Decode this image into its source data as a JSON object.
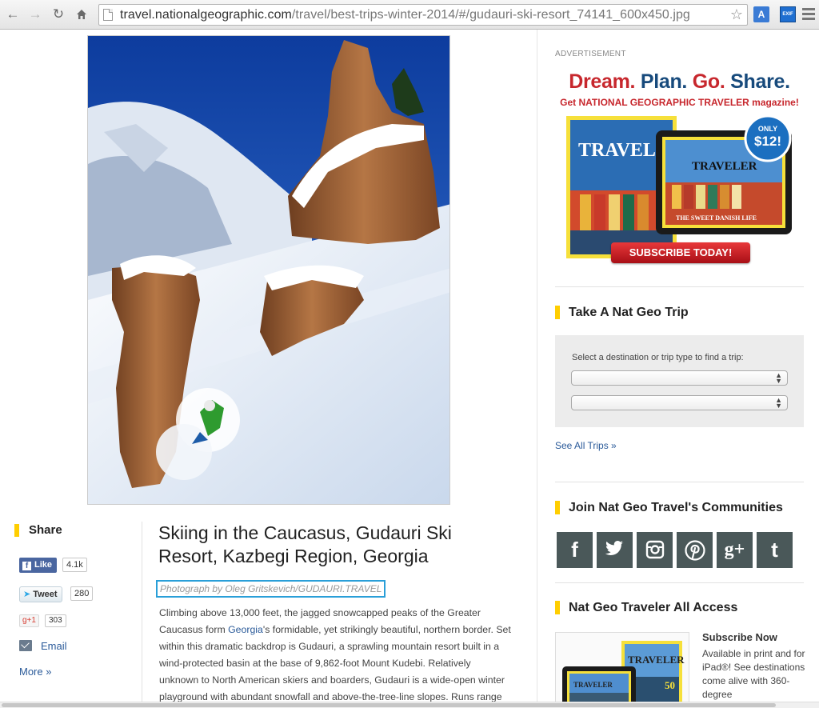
{
  "browser": {
    "url_host": "travel.nationalgeographic.com",
    "url_path": "/travel/best-trips-winter-2014/#/gudauri-ski-resort_74141_600x450.jpg",
    "ext1_label": "A",
    "ext2_label": "EXIF"
  },
  "share": {
    "heading": "Share",
    "like_label": "Like",
    "like_count": "4.1k",
    "tweet_label": "Tweet",
    "tweet_count": "280",
    "gplus_label": "g+1",
    "gplus_count": "303",
    "email_label": "Email",
    "more_label": "More »"
  },
  "article": {
    "title": "Skiing in the Caucasus, Gudauri Ski Resort, Kazbegi Region, Georgia",
    "credit": "Photograph by Oleg Gritskevich/GUDAURI.TRAVEL",
    "body_before_link": "Climbing above 13,000 feet, the jagged snowcapped peaks of the Greater Caucasus form ",
    "body_link": "Georgia",
    "body_after_link": "'s formidable, yet strikingly beautiful, northern border. Set within this dramatic backdrop is Gudauri, a sprawling mountain resort built in a wind-protected basin at the base of 9,862-foot Mount Kudebi. Relatively unknown to North American skiers and boarders, Gudauri is a wide-open winter playground with abundant snowfall and above-the-tree-line slopes. Runs range"
  },
  "sidebar": {
    "ad_label": "ADVERTISEMENT",
    "ad_headline_1": "Dream.",
    "ad_headline_2": "Plan.",
    "ad_headline_3": "Go.",
    "ad_headline_4": "Share.",
    "ad_sub": "Get NATIONAL GEOGRAPHIC TRAVELER magazine!",
    "ad_price_top": "ONLY",
    "ad_price": "$12!",
    "ad_mag_title": "TRAVELER",
    "ad_mag_cover_text": "THE SWEET DANISH LIFE",
    "ad_button": "SUBSCRIBE TODAY!",
    "trip_heading": "Take A Nat Geo Trip",
    "trip_label": "Select a destination or trip type to find a trip:",
    "trip_select_1": "",
    "trip_select_2": "",
    "see_all": "See All Trips »",
    "communities_heading": "Join Nat Geo Travel's Communities",
    "social_icons": [
      "facebook-icon",
      "twitter-icon",
      "instagram-icon",
      "pinterest-icon",
      "google-plus-icon",
      "tumblr-icon"
    ],
    "access_heading": "Nat Geo Traveler All Access",
    "access_title": "Subscribe Now",
    "access_text": "Available in print and for iPad®! See destinations come alive with 360-degree",
    "access_mag_title": "TRAVELER",
    "access_mag_num": "50"
  },
  "colors": {
    "accent_yellow": "#ffce00",
    "link_blue": "#2a5a99",
    "credit_border": "#2a9fd8",
    "social_tile": "#4a5859"
  }
}
